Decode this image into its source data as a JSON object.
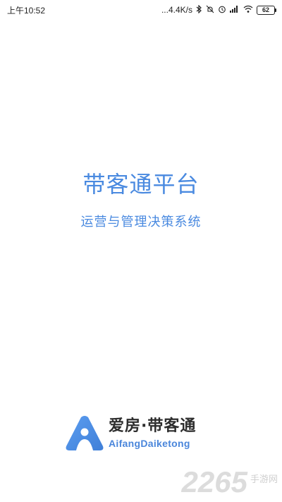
{
  "status_bar": {
    "time": "上午10:52",
    "network_speed": "...4.4K/s",
    "battery_level": "62",
    "icons": [
      "bluetooth-icon",
      "mute-icon",
      "alarm-icon",
      "signal-icon",
      "wifi-icon",
      "battery-icon"
    ]
  },
  "splash": {
    "title": "带客通平台",
    "subtitle": "运营与管理决策系统"
  },
  "brand": {
    "name_cn": "爱房·带客通",
    "name_en": "AifangDaiketong",
    "color": "#4a86db"
  },
  "watermark": {
    "number": "2265",
    "text": "手游网"
  }
}
